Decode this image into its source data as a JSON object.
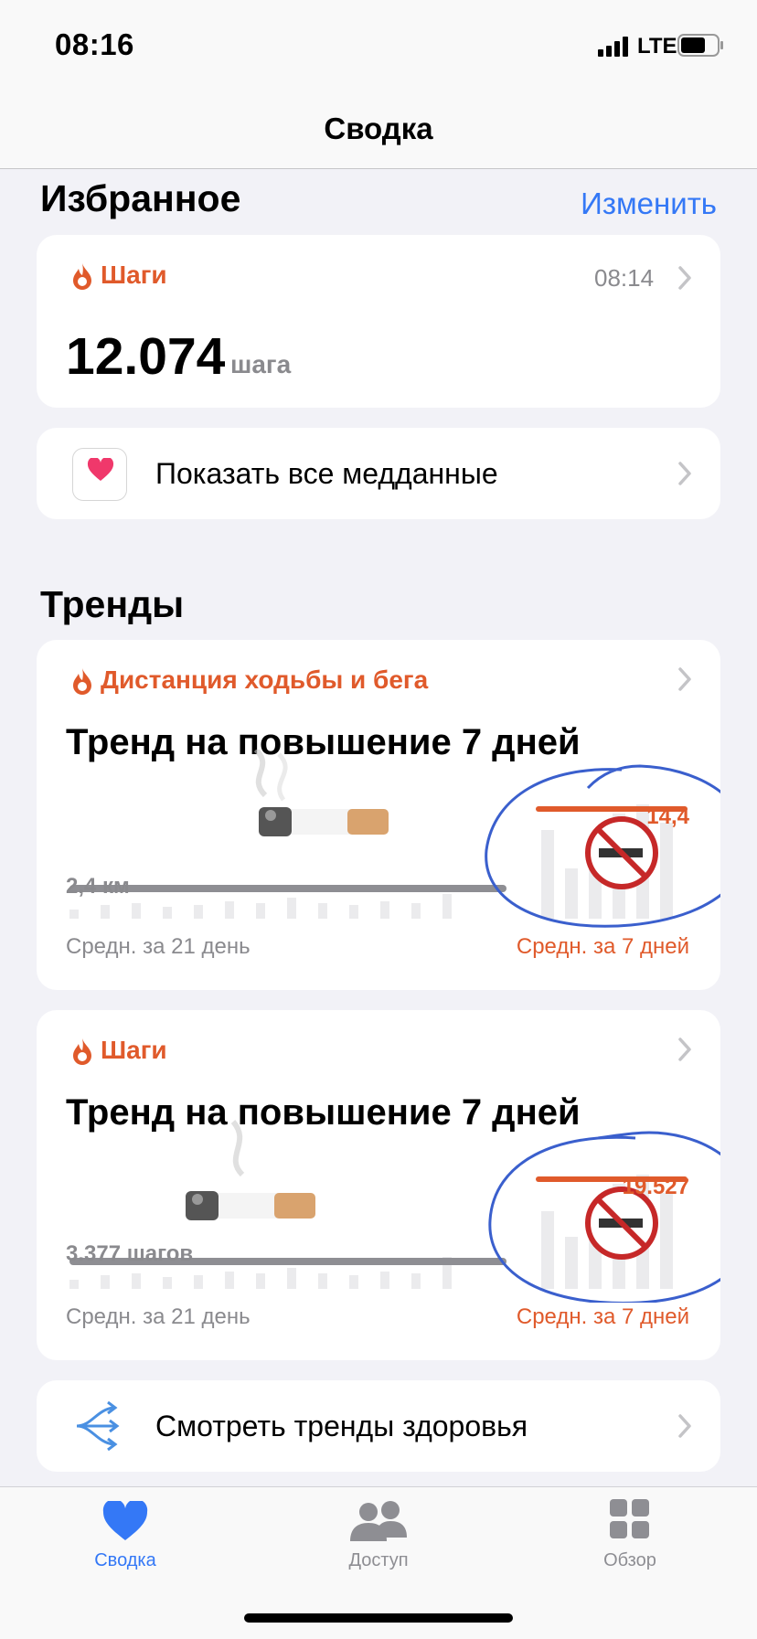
{
  "status": {
    "time": "08:16",
    "network": "LTE"
  },
  "nav": {
    "title": "Сводка"
  },
  "favorites": {
    "heading": "Избранное",
    "edit": "Изменить",
    "steps_card": {
      "label": "Шаги",
      "time": "08:14",
      "value": "12.074",
      "unit": "шага"
    },
    "all_data": "Показать все медданные"
  },
  "trends": {
    "heading": "Тренды",
    "cards": [
      {
        "category": "Дистанция ходьбы и бега",
        "title": "Тренд на повышение 7 дней",
        "avg21_value": "2,4 км",
        "avg7_value": "14,4",
        "avg21_label": "Средн. за 21 день",
        "avg7_label": "Средн. за 7 дней"
      },
      {
        "category": "Шаги",
        "title": "Тренд на повышение 7 дней",
        "avg21_value": "3.377 шагов",
        "avg7_value": "19.527",
        "avg21_label": "Средн. за 21 день",
        "avg7_label": "Средн. за 7 дней"
      }
    ],
    "view_trends": "Смотреть тренды здоровья"
  },
  "tabs": [
    {
      "label": "Сводка",
      "icon": "heart-icon",
      "active": true
    },
    {
      "label": "Доступ",
      "icon": "people-icon",
      "active": false
    },
    {
      "label": "Обзор",
      "icon": "grid-icon",
      "active": false
    }
  ],
  "colors": {
    "accent": "#3478f6",
    "orange": "#e05a2b",
    "annotation": "#3a5fcd"
  }
}
